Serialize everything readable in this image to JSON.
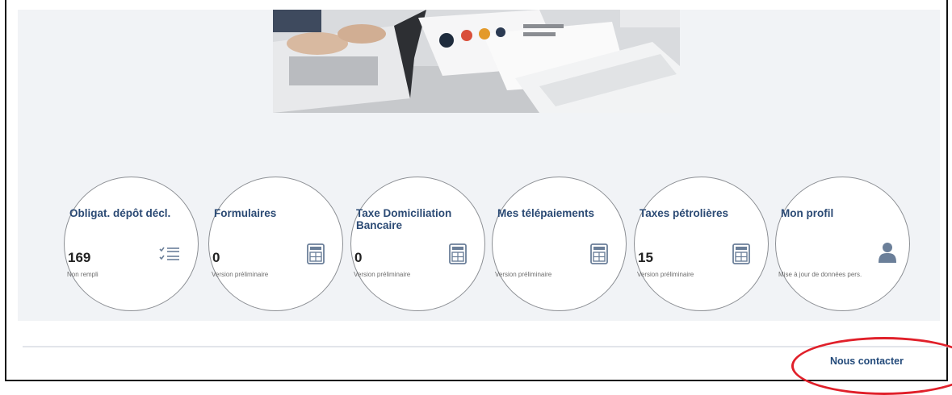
{
  "hero": {
    "alt": "Photo: hands typing on laptops with printed charts"
  },
  "tiles": [
    {
      "title": "Obligat. dépôt décl.",
      "count": "169",
      "subtitle": "Non rempli",
      "icon": "checklist-icon"
    },
    {
      "title": "Formulaires",
      "count": "0",
      "subtitle": "Version préliminaire",
      "icon": "form-icon"
    },
    {
      "title": "Taxe Domiciliation Bancaire",
      "count": "0",
      "subtitle": "Version préliminaire",
      "icon": "form-icon"
    },
    {
      "title": "Mes télépaiements",
      "count": "",
      "subtitle": "Version préliminaire",
      "icon": "form-icon"
    },
    {
      "title": "Taxes pétrolières",
      "count": "15",
      "subtitle": "Version préliminaire",
      "icon": "form-icon"
    },
    {
      "title": "Mon profil",
      "count": "",
      "subtitle": "Mise à jour de données pers.",
      "icon": "user-icon"
    }
  ],
  "footer": {
    "contact_label": "Nous contacter"
  },
  "colors": {
    "panel_bg": "#f1f3f6",
    "title": "#2b4a74",
    "highlight": "#e0202a"
  }
}
